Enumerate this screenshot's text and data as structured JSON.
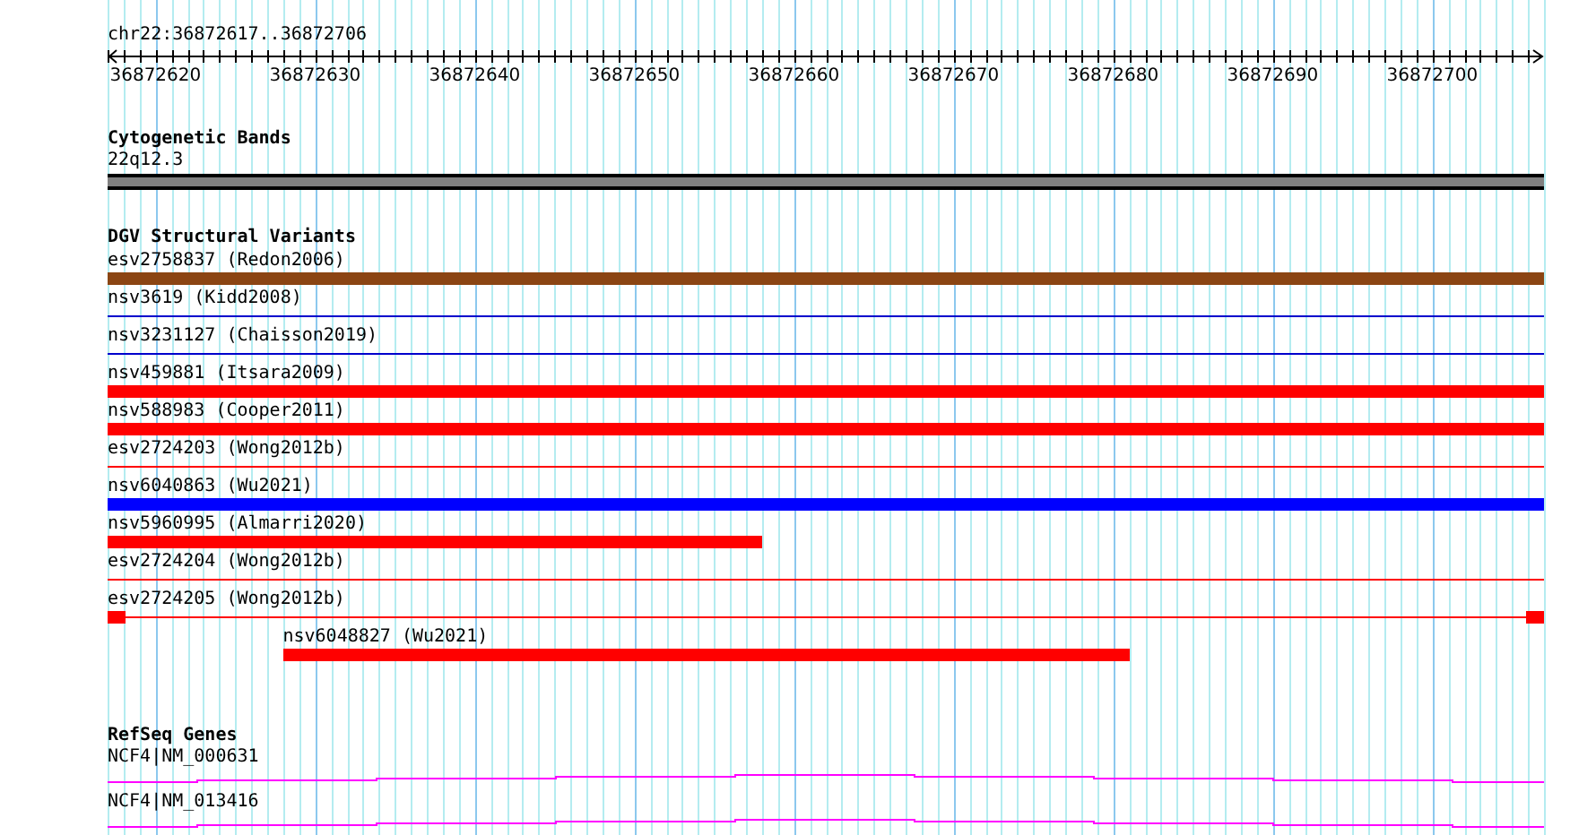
{
  "location": "chr22:36872617..36872706",
  "ruler": {
    "ticks": [
      "36872620",
      "36872630",
      "36872640",
      "36872650",
      "36872660",
      "36872670",
      "36872680",
      "36872690",
      "36872700"
    ]
  },
  "cytogenetic_bands": {
    "title": "Cytogenetic Bands",
    "bands": [
      {
        "label": "22q12.3"
      }
    ]
  },
  "dgv": {
    "title": "DGV Structural Variants",
    "features": [
      {
        "label": "esv2758837 (Redon2006)",
        "kind": "thick",
        "color": "#8b4513"
      },
      {
        "label": "nsv3619 (Kidd2008)",
        "kind": "thin",
        "color": "#0000cc"
      },
      {
        "label": "nsv3231127 (Chaisson2019)",
        "kind": "thin",
        "color": "#0000cc"
      },
      {
        "label": "nsv459881 (Itsara2009)",
        "kind": "thick",
        "color": "#ff0000"
      },
      {
        "label": "nsv588983 (Cooper2011)",
        "kind": "thick",
        "color": "#ff0000"
      },
      {
        "label": "esv2724203 (Wong2012b)",
        "kind": "thin",
        "color": "#ff0000"
      },
      {
        "label": "nsv6040863 (Wu2021)",
        "kind": "thick",
        "color": "#0000ff"
      },
      {
        "label": "nsv5960995 (Almarri2020)",
        "kind": "thick",
        "color": "#ff0000"
      },
      {
        "label": "esv2724204 (Wong2012b)",
        "kind": "thin",
        "color": "#ff0000"
      },
      {
        "label": "esv2724205 (Wong2012b)",
        "kind": "capped",
        "color": "#ff0000"
      },
      {
        "label": "nsv6048827 (Wu2021)",
        "kind": "thick",
        "color": "#ff0000"
      }
    ]
  },
  "refseq": {
    "title": "RefSeq Genes",
    "genes": [
      {
        "label": "NCF4|NM_000631"
      },
      {
        "label": "NCF4|NM_013416"
      }
    ]
  }
}
